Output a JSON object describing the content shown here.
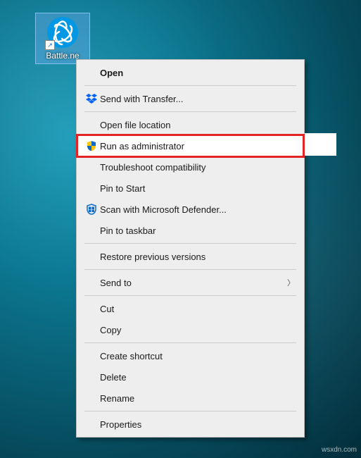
{
  "desktop": {
    "icon": {
      "label": "Battle.ne"
    }
  },
  "menu": {
    "items": {
      "open": "Open",
      "send_transfer": "Send with Transfer...",
      "open_location": "Open file location",
      "run_admin": "Run as administrator",
      "troubleshoot": "Troubleshoot compatibility",
      "pin_start": "Pin to Start",
      "scan_defender": "Scan with Microsoft Defender...",
      "pin_taskbar": "Pin to taskbar",
      "restore": "Restore previous versions",
      "send_to": "Send to",
      "cut": "Cut",
      "copy": "Copy",
      "create_shortcut": "Create shortcut",
      "delete": "Delete",
      "rename": "Rename",
      "properties": "Properties"
    }
  },
  "watermark": "wsxdn.com",
  "highlight_color": "#e32424"
}
